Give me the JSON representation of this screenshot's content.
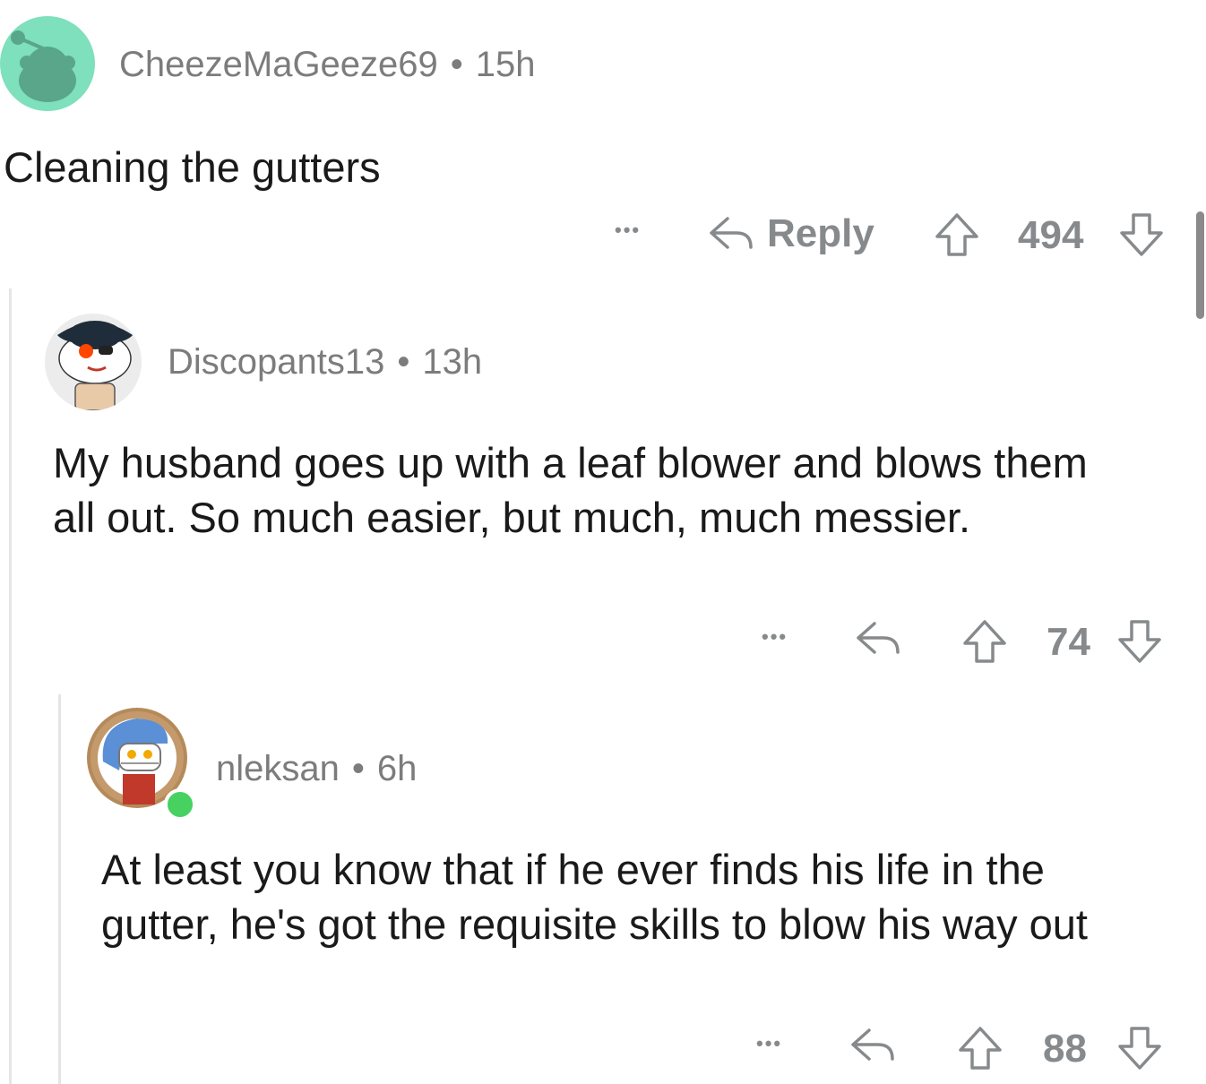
{
  "comments": [
    {
      "username": "CheezeMaGeeze69",
      "separator": "•",
      "time": "15h",
      "text": "Cleaning the gutters",
      "more": "•••",
      "reply_label": "Reply",
      "votes": "494"
    },
    {
      "username": "Discopants13",
      "separator": "•",
      "time": "13h",
      "text": "My husband goes up with a leaf blower and blows them all out. So much easier, but much, much messier.",
      "more": "•••",
      "votes": "74"
    },
    {
      "username": "nleksan",
      "separator": "•",
      "time": "6h",
      "text": "At least you know that if he ever finds his life in the gutter, he's got the requisite skills to blow his way out",
      "more": "•••",
      "votes": "88"
    }
  ],
  "colors": {
    "avatar_1_bg": "#7ee0bd",
    "text_primary": "#1a1a1b",
    "text_meta": "#7c7c7c",
    "online_indicator": "#46d160"
  },
  "icons": [
    "snoo-avatar-icon",
    "reply-arrow-icon",
    "upvote-arrow-icon",
    "downvote-arrow-icon",
    "more-options-icon"
  ]
}
